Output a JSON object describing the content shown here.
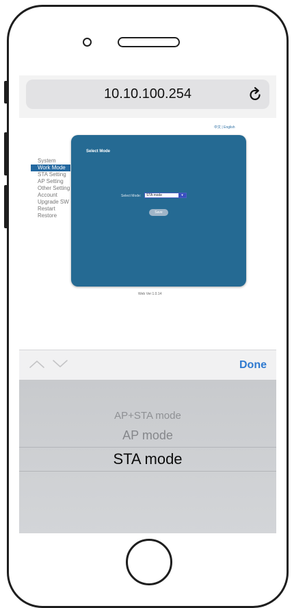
{
  "browser": {
    "url": "10.10.100.254",
    "reload_icon": "reload-icon"
  },
  "web": {
    "lang": {
      "chinese": "中文",
      "separator": "|",
      "english": "English"
    },
    "menu": [
      {
        "label": "System",
        "active": false
      },
      {
        "label": "Work Mode",
        "active": true
      },
      {
        "label": "STA Setting",
        "active": false
      },
      {
        "label": "AP Setting",
        "active": false
      },
      {
        "label": "Other Setting",
        "active": false
      },
      {
        "label": "Account",
        "active": false
      },
      {
        "label": "Upgrade SW",
        "active": false
      },
      {
        "label": "Restart",
        "active": false
      },
      {
        "label": "Restore",
        "active": false
      }
    ],
    "panel": {
      "title": "Select Mode",
      "mode_label": "Select Mode:",
      "mode_value": "STA mode",
      "save_label": "Save"
    },
    "version": "Web Ver:1.0.14"
  },
  "picker": {
    "done_label": "Done",
    "options": [
      "AP+STA mode",
      "AP mode",
      "STA mode"
    ],
    "selected": "STA mode"
  },
  "colors": {
    "panel": "#256a93",
    "menu_active": "#2368a0",
    "done": "#2f7ad0"
  }
}
